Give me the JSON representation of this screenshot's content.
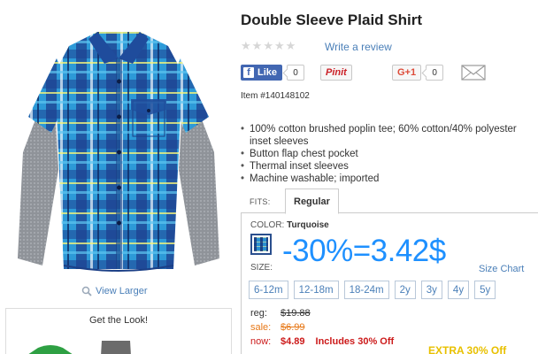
{
  "product": {
    "title": "Double Sleeve Plaid Shirt",
    "rating_stars": 5,
    "write_review": "Write a review",
    "item_number": "Item #140148102",
    "features": [
      "100% cotton brushed poplin tee; 60% cotton/40% polyester inset sleeves",
      "Button flap chest pocket",
      "Thermal inset sleeves",
      "Machine washable; imported"
    ]
  },
  "social": {
    "facebook_label": "Like",
    "facebook_count": "0",
    "pinterest_label": "Pinit",
    "gplus_label": "G+1",
    "gplus_count": "0",
    "email_icon": "envelope-icon"
  },
  "image": {
    "view_larger": "View Larger",
    "get_the_look": "Get the Look!"
  },
  "fits": {
    "label": "FITS:",
    "selected": "Regular"
  },
  "options": {
    "color_label": "COLOR:",
    "color_value": "Turquoise",
    "promo_text": "-30%=3.42$",
    "size_label": "SIZE:",
    "size_chart": "Size Chart",
    "sizes": [
      "6-12m",
      "12-18m",
      "18-24m",
      "2y",
      "3y",
      "4y",
      "5y"
    ]
  },
  "pricing": {
    "reg_label": "reg:",
    "reg_value": "$19.88",
    "sale_label": "sale:",
    "sale_value": "$6.99",
    "now_label": "now:",
    "now_value": "$4.89",
    "now_note": "Includes 30% Off",
    "extra_banner": "EXTRA 30% Off"
  },
  "colors": {
    "link": "#4a7fb8",
    "promo": "#1e90ff",
    "sale": "#e77817",
    "now": "#cc1a1a",
    "facebook": "#4267b2",
    "pinterest": "#cb2027"
  }
}
